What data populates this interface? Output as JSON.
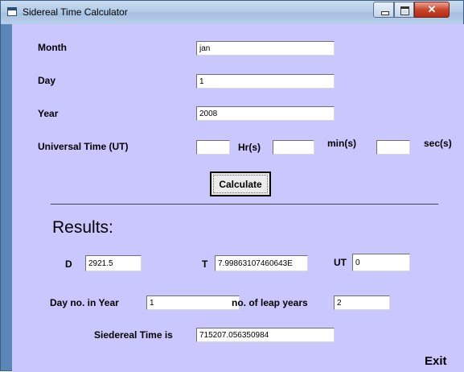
{
  "window": {
    "title": "Sidereal Time Calculator"
  },
  "form": {
    "month_label": "Month",
    "month_value": "jan",
    "day_label": "Day",
    "day_value": "1",
    "year_label": "Year",
    "year_value": "2008",
    "ut_label": "Universal Time (UT)",
    "hr_label": "Hr(s)",
    "min_label": "min(s)",
    "sec_label": "sec(s)",
    "hr_value": "",
    "min_value": "",
    "sec_value": "",
    "calculate_label": "Calculate"
  },
  "results": {
    "heading": "Results:",
    "d_label": "D",
    "d_value": "2921.5",
    "t_label": "T",
    "t_value": "7.99863107460643E",
    "ut_label": "UT",
    "ut_value": "0",
    "dayno_label": "Day no. in Year",
    "dayno_value": "1",
    "leap_label": "no. of leap years",
    "leap_value": "2",
    "sidereal_label": "Siedereal Time is",
    "sidereal_value": "715207.056350984"
  },
  "exit_label": "Exit"
}
